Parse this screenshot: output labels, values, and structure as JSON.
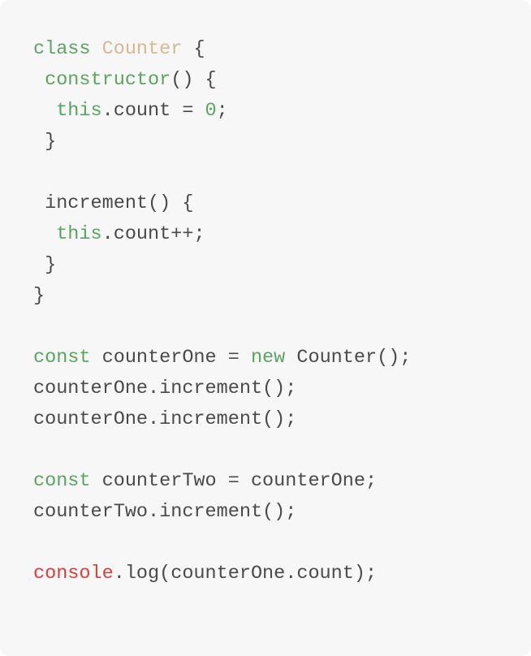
{
  "theme": {
    "background": "#f7f7f7",
    "text": "#4a4a4a",
    "keyword": "#5aa55f",
    "class_name": "#d7b98e",
    "number": "#5aa55f",
    "global": "#dc3d3d"
  },
  "code": {
    "lines": [
      {
        "tokens": [
          {
            "text": "class ",
            "kind": "keyword"
          },
          {
            "text": "Counter",
            "kind": "class-name"
          },
          {
            "text": " {",
            "kind": "plain"
          }
        ]
      },
      {
        "tokens": [
          {
            "text": " constructor",
            "kind": "keyword"
          },
          {
            "text": "() {",
            "kind": "plain"
          }
        ]
      },
      {
        "tokens": [
          {
            "text": "  this",
            "kind": "keyword"
          },
          {
            "text": ".count = ",
            "kind": "plain"
          },
          {
            "text": "0",
            "kind": "number"
          },
          {
            "text": ";",
            "kind": "plain"
          }
        ]
      },
      {
        "tokens": [
          {
            "text": " }",
            "kind": "plain"
          }
        ]
      },
      {
        "tokens": [
          {
            "text": "",
            "kind": "plain"
          }
        ]
      },
      {
        "tokens": [
          {
            "text": " increment() {",
            "kind": "plain"
          }
        ]
      },
      {
        "tokens": [
          {
            "text": "  this",
            "kind": "keyword"
          },
          {
            "text": ".count++;",
            "kind": "plain"
          }
        ]
      },
      {
        "tokens": [
          {
            "text": " }",
            "kind": "plain"
          }
        ]
      },
      {
        "tokens": [
          {
            "text": "}",
            "kind": "plain"
          }
        ]
      },
      {
        "tokens": [
          {
            "text": "",
            "kind": "plain"
          }
        ]
      },
      {
        "tokens": [
          {
            "text": "const",
            "kind": "keyword"
          },
          {
            "text": " counterOne = ",
            "kind": "plain"
          },
          {
            "text": "new",
            "kind": "keyword"
          },
          {
            "text": " Counter();",
            "kind": "plain"
          }
        ]
      },
      {
        "tokens": [
          {
            "text": "counterOne.increment();",
            "kind": "plain"
          }
        ]
      },
      {
        "tokens": [
          {
            "text": "counterOne.increment();",
            "kind": "plain"
          }
        ]
      },
      {
        "tokens": [
          {
            "text": "",
            "kind": "plain"
          }
        ]
      },
      {
        "tokens": [
          {
            "text": "const",
            "kind": "keyword"
          },
          {
            "text": " counterTwo = counterOne;",
            "kind": "plain"
          }
        ]
      },
      {
        "tokens": [
          {
            "text": "counterTwo.increment();",
            "kind": "plain"
          }
        ]
      },
      {
        "tokens": [
          {
            "text": "",
            "kind": "plain"
          }
        ]
      },
      {
        "tokens": [
          {
            "text": "console",
            "kind": "global"
          },
          {
            "text": ".log(counterOne.count);",
            "kind": "plain"
          }
        ]
      }
    ]
  }
}
